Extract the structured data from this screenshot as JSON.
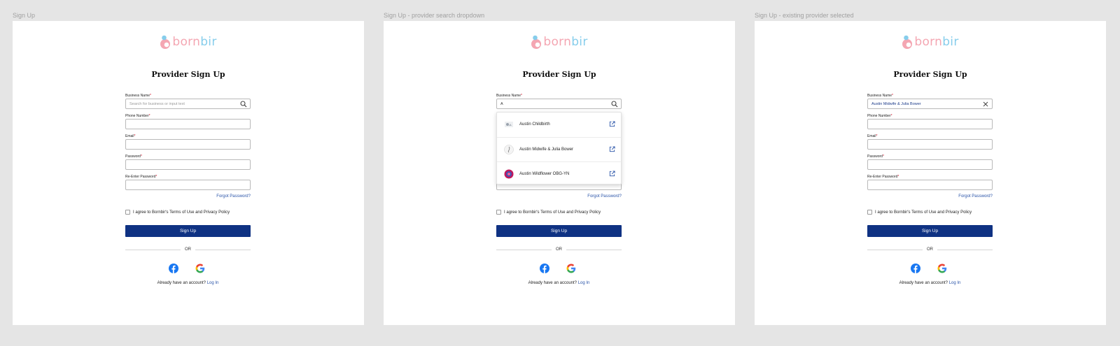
{
  "frames": [
    {
      "label": "Sign Up",
      "variant": "default",
      "title": "Provider Sign Up",
      "business_value": "",
      "business_placeholder": "Search for business or input text"
    },
    {
      "label": "Sign Up - provider search dropdown",
      "variant": "dropdown",
      "title": "Provider Sign Up",
      "business_value": "A",
      "business_placeholder": "Search for business or input text"
    },
    {
      "label": "Sign Up - existing provider selected",
      "variant": "selected",
      "title": "Provider Sign Up",
      "business_value": "Austin Midwife & Julia Bower",
      "business_placeholder": "Search for business or input text"
    }
  ],
  "logo": {
    "part1": "born",
    "part2": "bir"
  },
  "form": {
    "business_label": "Business Name",
    "phone_label": "Phone Number",
    "email_label": "Email",
    "password_label": "Password",
    "reenter_label": "Re-Enter Password",
    "required_mark": "*",
    "forgot": "Forgot Password?",
    "agree": "I agree to Bornbir's Terms of Use and Privacy Policy",
    "signup_button": "Sign Up",
    "or": "OR",
    "already": "Already have an account?",
    "login": "Log In"
  },
  "dropdown_items": [
    {
      "name": "Austin Childbirth",
      "thumb": "childbirth-logo-icon"
    },
    {
      "name": "Austin Midwife & Julia Bower",
      "thumb": "midwife-logo-icon"
    },
    {
      "name": "Austin Wildflower OBG-YN",
      "thumb": "wildflower-logo-icon"
    }
  ],
  "colors": {
    "primary_button": "#0f3283",
    "link": "#2a54a8",
    "required": "#d0021b",
    "logo_pink": "#f4a6b2",
    "logo_blue": "#86cdeb",
    "background": "#e5e5e5"
  },
  "icons": [
    "search-icon",
    "clear-icon",
    "facebook-icon",
    "google-icon",
    "external-link-icon"
  ]
}
